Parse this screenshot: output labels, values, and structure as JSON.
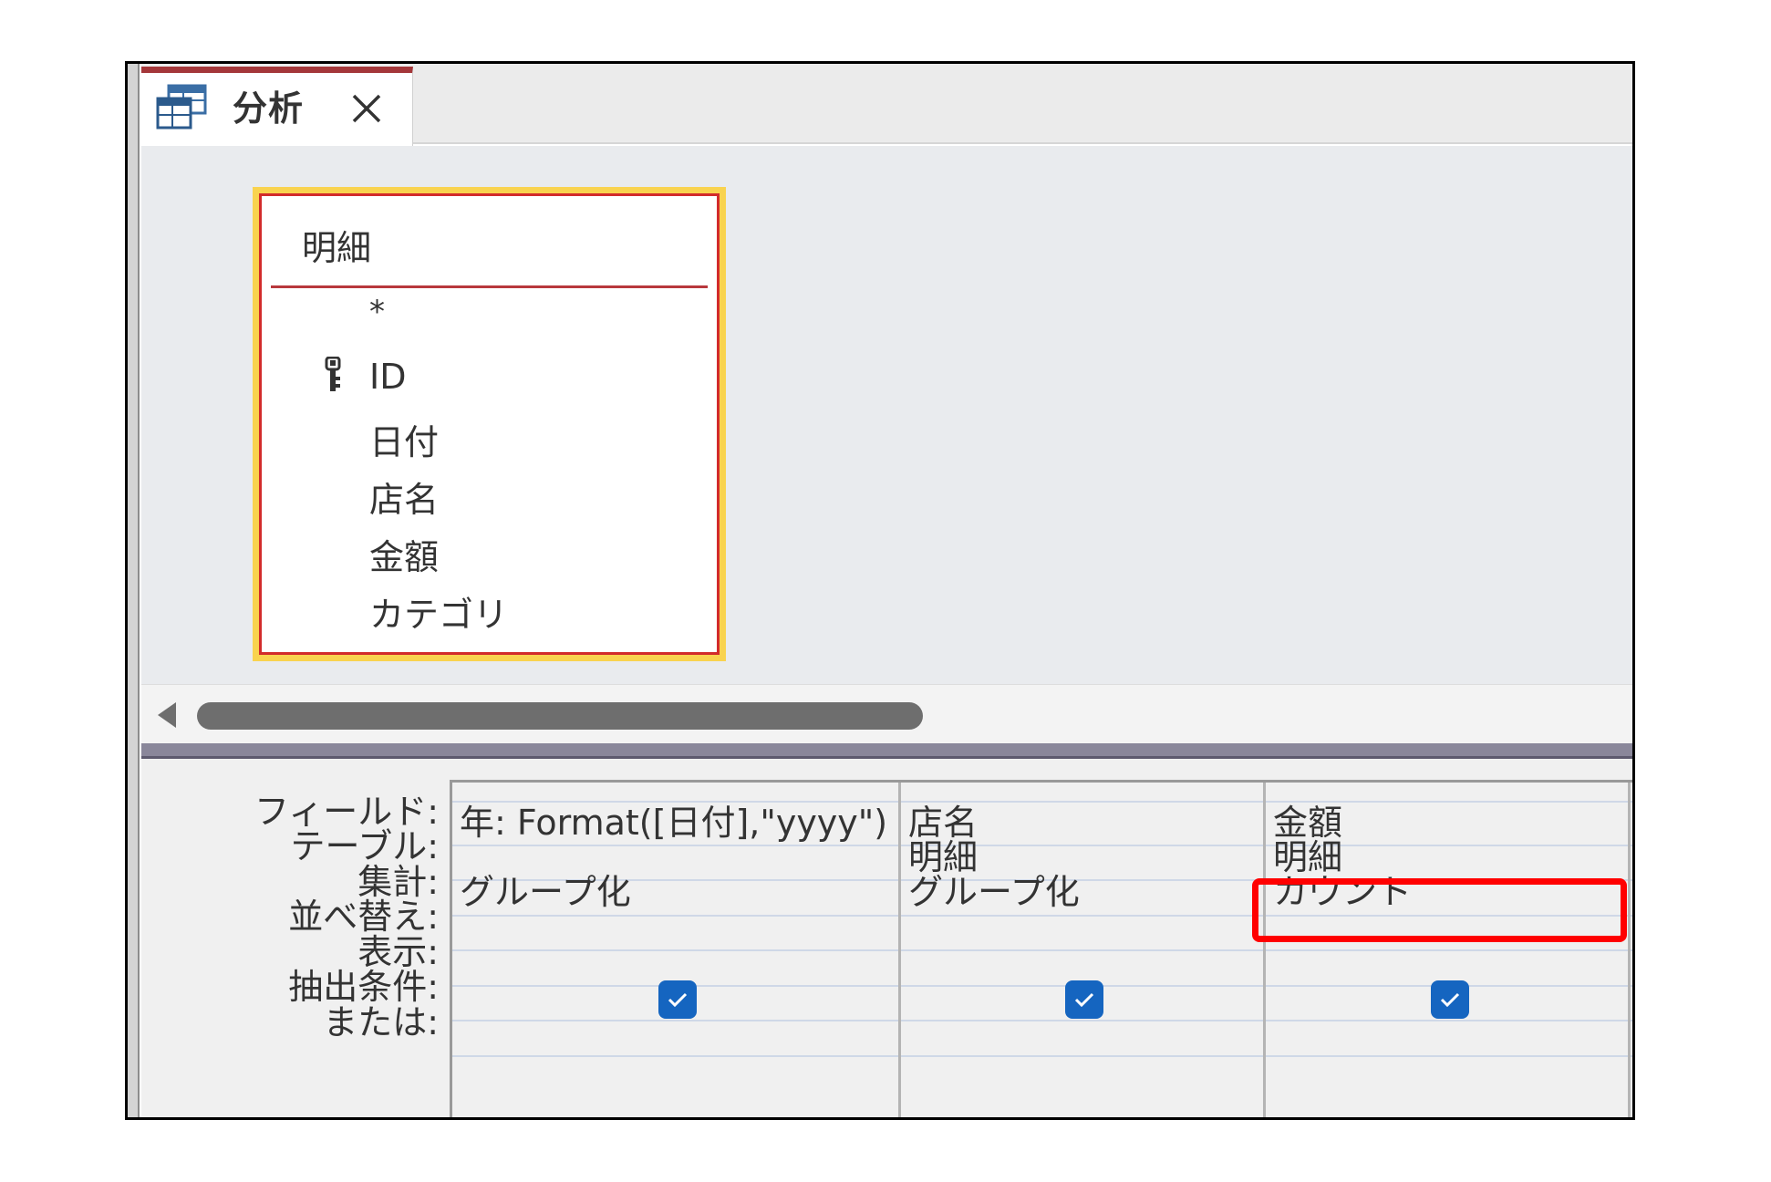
{
  "tab": {
    "title": "分析",
    "icon": "query-design-icon",
    "close_icon": "close-icon"
  },
  "table": {
    "name": "明細",
    "fields": [
      "*",
      "ID",
      "日付",
      "店名",
      "金額",
      "カテゴリ"
    ],
    "primary_key_field": "ID",
    "key_icon": "primary-key-icon"
  },
  "grid": {
    "row_labels": [
      "フィールド:",
      "テーブル:",
      "集計:",
      "並べ替え:",
      "表示:",
      "抽出条件:",
      "または:"
    ],
    "columns": [
      {
        "field": "年: Format([日付],\"yyyy\")",
        "table": "",
        "total": "グループ化",
        "sort": "",
        "show": true,
        "criteria": "",
        "or": ""
      },
      {
        "field": "店名",
        "table": "明細",
        "total": "グループ化",
        "sort": "",
        "show": true,
        "criteria": "",
        "or": ""
      },
      {
        "field": "金額",
        "table": "明細",
        "total": "カウント",
        "sort": "",
        "show": true,
        "criteria": "",
        "or": ""
      }
    ]
  },
  "annotation": {
    "highlight_target": "カウント",
    "highlight_color": "#ff0000"
  },
  "colors": {
    "tab_accent": "#a4373a",
    "table_selection_outline": "#f9d34f",
    "table_border": "#d22b2b",
    "checkbox": "#1565c0"
  }
}
